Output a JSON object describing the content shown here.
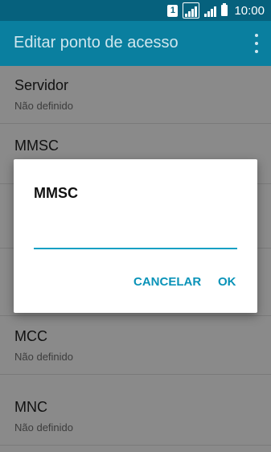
{
  "status_bar": {
    "sim_label": "1",
    "time": "10:00"
  },
  "app_bar": {
    "title": "Editar ponto de acesso"
  },
  "list": {
    "items": [
      {
        "label": "Servidor",
        "value": "Não definido"
      },
      {
        "label": "MMSC",
        "value": ""
      },
      {
        "label": "",
        "value": ""
      },
      {
        "label": "",
        "value": ""
      },
      {
        "label": "MCC",
        "value": "Não definido"
      },
      {
        "label": "MNC",
        "value": "Não definido"
      }
    ]
  },
  "dialog": {
    "title": "MMSC",
    "input_value": "",
    "cancel_label": "CANCELAR",
    "ok_label": "OK"
  },
  "colors": {
    "status_bar": "#06617d",
    "app_bar": "#0a7f9f",
    "accent": "#0a93b8",
    "input_underline": "#16a0c4"
  }
}
